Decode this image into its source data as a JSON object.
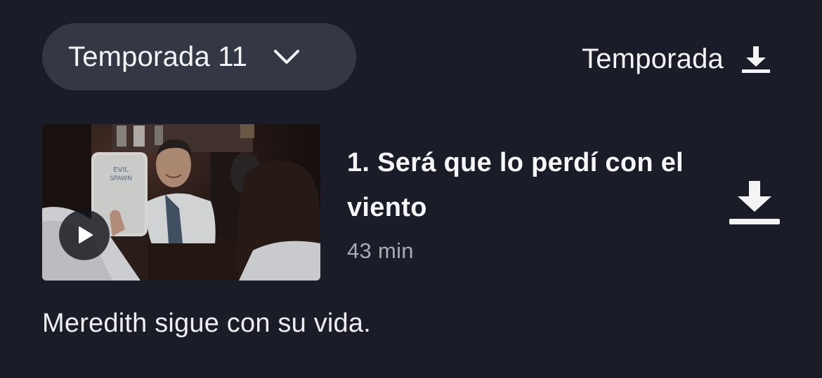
{
  "season_selector": {
    "label": "Temporada 11",
    "icon": "chevron-down-icon"
  },
  "season_download": {
    "label": "Temporada",
    "icon": "download-icon"
  },
  "episode": {
    "title": "1. Será que lo perdí con el viento",
    "duration": "43 min",
    "description": "Meredith sigue con su vida.",
    "thumbnail_sign_text": "EVIL SPAWN",
    "play_icon": "play-icon",
    "download_icon": "download-icon"
  },
  "colors": {
    "background": "#1a1c27",
    "pill": "#343844",
    "secondary_text": "#a9abb3"
  }
}
